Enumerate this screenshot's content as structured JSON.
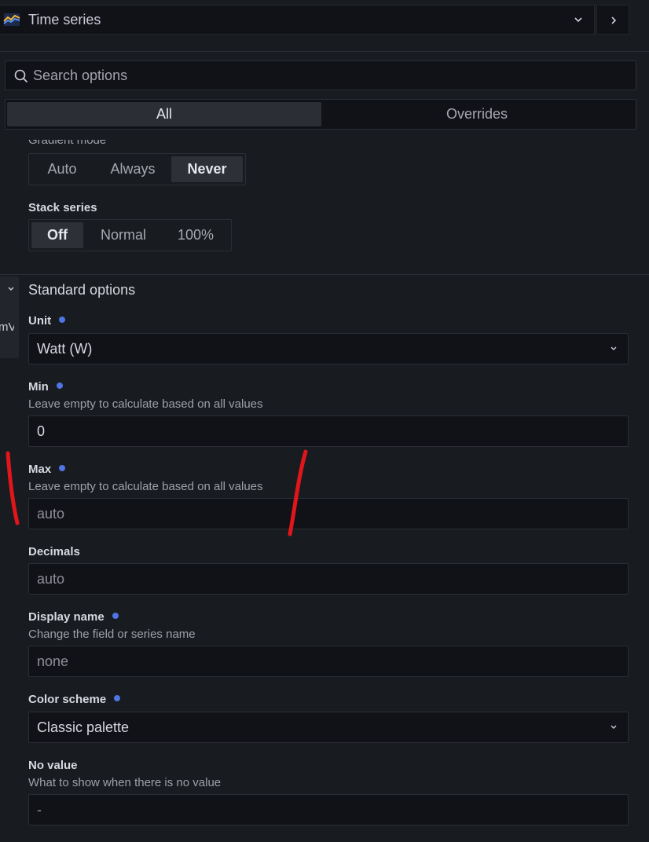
{
  "header": {
    "viz_title": "Time series",
    "viz_icon": "time-series-viz-icon"
  },
  "search": {
    "placeholder": "Search options"
  },
  "tabs": [
    {
      "label": "All",
      "active": true
    },
    {
      "label": "Overrides",
      "active": false
    }
  ],
  "gradient_options": {
    "label_partial": "Gradient mode",
    "options": [
      "Auto",
      "Always",
      "Never"
    ],
    "selected": "Never"
  },
  "stack_series": {
    "label": "Stack series",
    "options": [
      "Off",
      "Normal",
      "100%"
    ],
    "selected": "Off"
  },
  "side_tab": {
    "text": "mV"
  },
  "standard_options": {
    "title": "Standard options",
    "unit": {
      "label": "Unit",
      "value": "Watt (W)"
    },
    "min": {
      "label": "Min",
      "description": "Leave empty to calculate based on all values",
      "value": "0"
    },
    "max": {
      "label": "Max",
      "description": "Leave empty to calculate based on all values",
      "placeholder": "auto"
    },
    "decimals": {
      "label": "Decimals",
      "placeholder": "auto"
    },
    "display_name": {
      "label": "Display name",
      "description": "Change the field or series name",
      "placeholder": "none"
    },
    "color_scheme": {
      "label": "Color scheme",
      "value": "Classic palette"
    },
    "no_value": {
      "label": "No value",
      "description": "What to show when there is no value",
      "placeholder": "-"
    }
  },
  "colors": {
    "background": "#181b1f",
    "input_bg": "#111217",
    "border": "#2b2e35",
    "modified_dot": "#4f74e3",
    "annotation": "#e0161b"
  }
}
